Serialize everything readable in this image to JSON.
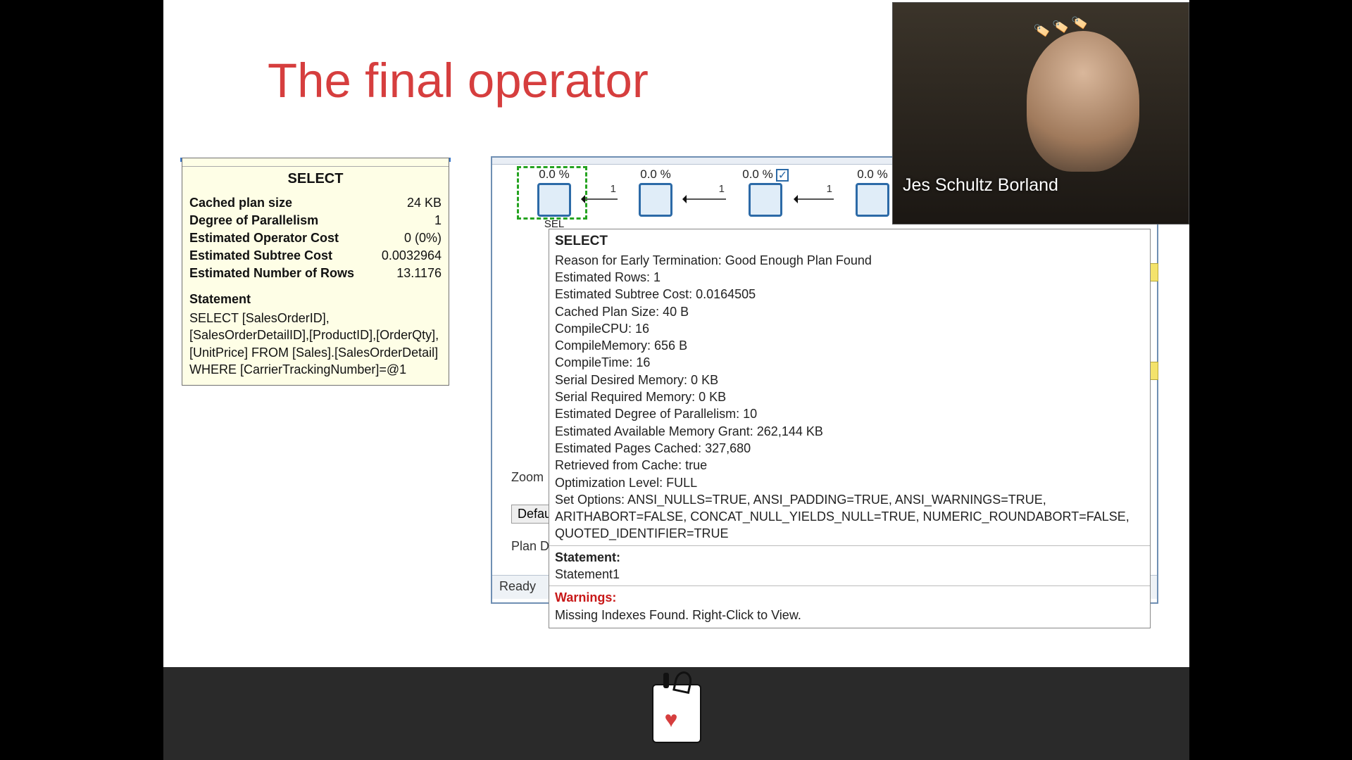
{
  "slide": {
    "title": "The final operator"
  },
  "left_tooltip": {
    "header": "SELECT",
    "rows": [
      {
        "k": "Cached plan size",
        "v": "24 KB"
      },
      {
        "k": "Degree of Parallelism",
        "v": "1"
      },
      {
        "k": "Estimated Operator Cost",
        "v": "0 (0%)"
      },
      {
        "k": "Estimated Subtree Cost",
        "v": "0.0032964"
      },
      {
        "k": "Estimated Number of Rows",
        "v": "13.1176"
      }
    ],
    "statement_label": "Statement",
    "statement_body": "SELECT [SalesOrderID],[SalesOrderDetailID],[ProductID],[OrderQty],[UnitPrice] FROM [Sales].[SalesOrderDetail] WHERE [CarrierTrackingNumber]=@1"
  },
  "plan": {
    "ops": [
      {
        "pct": "0.0 %",
        "label": "SEL"
      },
      {
        "pct": "0.0 %",
        "label": ""
      },
      {
        "pct": "0.0 %",
        "label": "",
        "check": true
      },
      {
        "pct": "0.0 %",
        "label": ""
      }
    ],
    "arrow_count": "1"
  },
  "details": {
    "header": "SELECT",
    "lines": [
      "Reason for Early Termination:  Good Enough Plan Found",
      "Estimated Rows:  1",
      "Estimated Subtree Cost:  0.0164505",
      "Cached Plan Size:  40 B",
      "CompileCPU:  16",
      "CompileMemory:  656 B",
      "CompileTime:  16",
      "Serial Desired Memory:  0 KB",
      "Serial Required Memory:  0 KB",
      "Estimated Degree of Parallelism:  10",
      "Estimated Available Memory Grant:  262,144 KB",
      "Estimated Pages Cached:  327,680",
      "Retrieved from Cache:  true",
      "Optimization Level:  FULL",
      "Set Options:  ANSI_NULLS=TRUE, ANSI_PADDING=TRUE, ANSI_WARNINGS=TRUE, ARITHABORT=FALSE, CONCAT_NULL_YIELDS_NULL=TRUE, NUMERIC_ROUNDABORT=FALSE, QUOTED_IDENTIFIER=TRUE"
    ],
    "statement_label": "Statement:",
    "statement_value": "Statement1",
    "warnings_label": "Warnings:",
    "warnings_value": "Missing Indexes Found. Right-Click to View."
  },
  "controls": {
    "zoom": "Zoom",
    "default": "Defau",
    "plan_d": "Plan D",
    "status": "Ready"
  },
  "webcam": {
    "name": "Jes Schultz Borland"
  }
}
